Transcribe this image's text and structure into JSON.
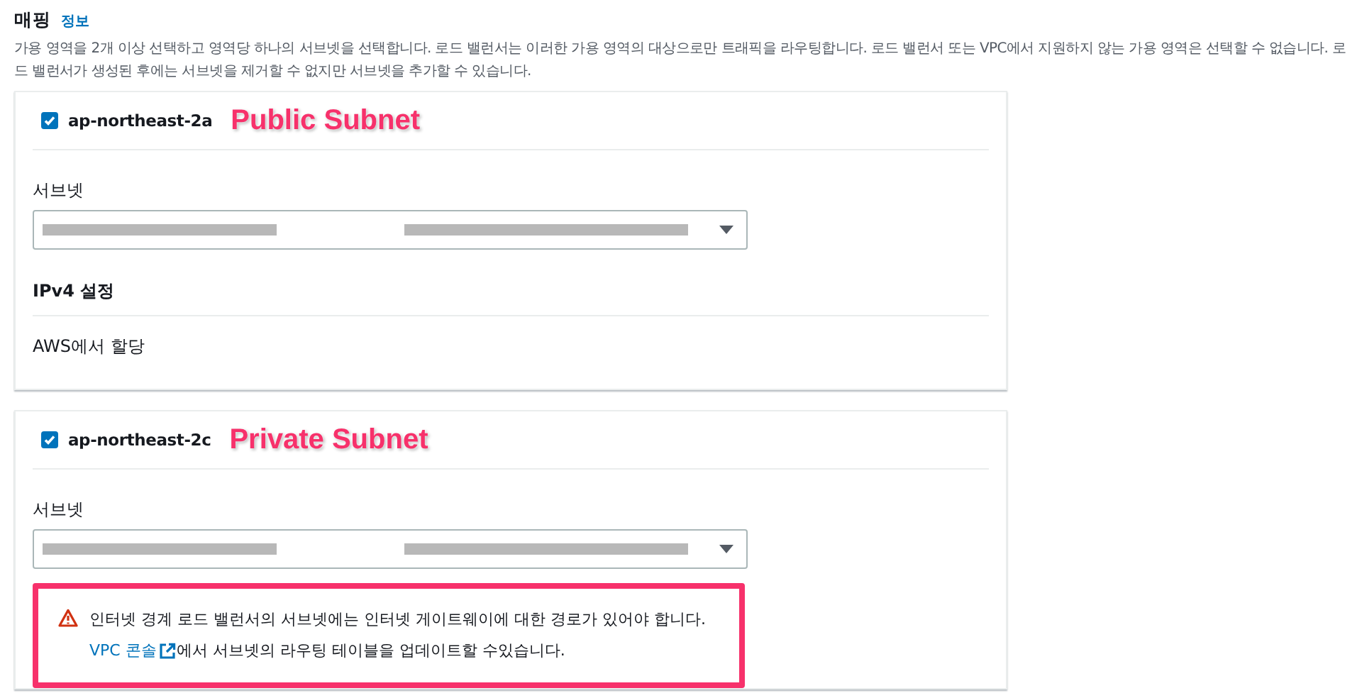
{
  "section": {
    "title": "매핑",
    "info_link": "정보",
    "description": "가용 영역을 2개 이상 선택하고 영역당 하나의 서브넷을 선택합니다. 로드 밸런서는 이러한 가용 영역의 대상으로만 트래픽을 라우팅합니다. 로드 밸런서 또는 VPC에서 지원하지 않는 가용 영역은 선택할 수 없습니다. 로드 밸런서가 생성된 후에는 서브넷을 제거할 수 없지만 서브넷을 추가할 수 있습니다."
  },
  "zones": [
    {
      "name": "ap-northeast-2a",
      "checked": true,
      "annotation": "Public Subnet",
      "subnet_label": "서브넷",
      "ipv4_heading": "IPv4 설정",
      "ipv4_value": "AWS에서 할당"
    },
    {
      "name": "ap-northeast-2c",
      "checked": true,
      "annotation": "Private Subnet",
      "subnet_label": "서브넷",
      "warning": {
        "message": "인터넷 경계 로드 밸런서의 서브넷에는 인터넷 게이트웨이에 대한 경로가 있어야 합니다.",
        "link": "VPC 콘솔",
        "rest": "에서 서브넷의 라우팅 테이블을 업데이트할 수있습니다.",
        "highlighted": true
      }
    }
  ]
}
